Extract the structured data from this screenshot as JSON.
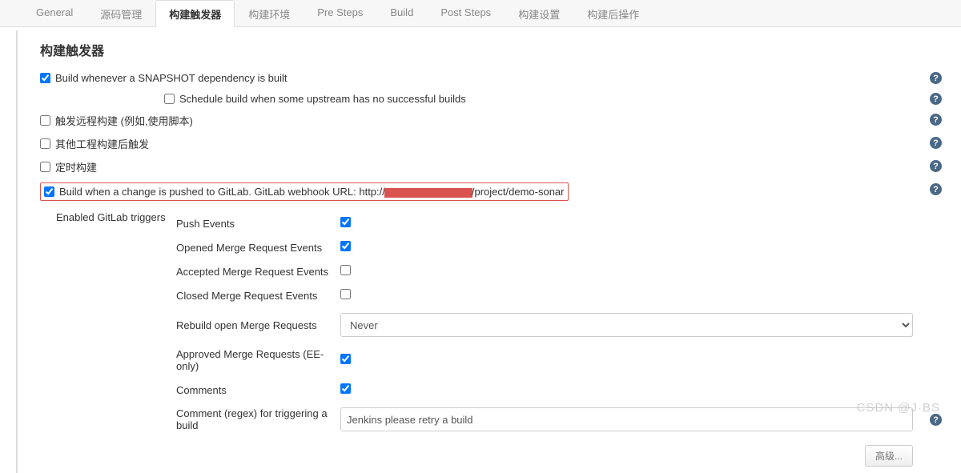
{
  "tabs": {
    "general": "General",
    "scm": "源码管理",
    "triggers": "构建触发器",
    "env": "构建环境",
    "pre": "Pre Steps",
    "build": "Build",
    "post": "Post Steps",
    "settings": "构建设置",
    "postbuild": "构建后操作"
  },
  "section_title": "构建触发器",
  "triggers": {
    "snapshot": {
      "checked": true,
      "label": "Build whenever a SNAPSHOT dependency is built"
    },
    "schedule_upstream": {
      "checked": false,
      "label": "Schedule build when some upstream has no successful builds"
    },
    "remote": {
      "checked": false,
      "label": "触发远程构建 (例如,使用脚本)"
    },
    "other_project": {
      "checked": false,
      "label": "其他工程构建后触发"
    },
    "timer": {
      "checked": false,
      "label": "定时构建"
    },
    "gitlab": {
      "checked": true,
      "label_prefix": "Build when a change is pushed to GitLab. GitLab webhook URL: http://",
      "label_suffix": "/project/demo-sonar"
    }
  },
  "gitlab_section": {
    "title": "Enabled GitLab triggers",
    "options": {
      "push": {
        "label": "Push Events",
        "checked": true
      },
      "opened_mr": {
        "label": "Opened Merge Request Events",
        "checked": true
      },
      "accepted_mr": {
        "label": "Accepted Merge Request Events",
        "checked": false
      },
      "closed_mr": {
        "label": "Closed Merge Request Events",
        "checked": false
      },
      "rebuild_mr": {
        "label": "Rebuild open Merge Requests",
        "value": "Never"
      },
      "approved_mr": {
        "label": "Approved Merge Requests (EE-only)",
        "checked": true
      },
      "comments": {
        "label": "Comments",
        "checked": true
      },
      "comment_regex": {
        "label": "Comment (regex) for triggering a build",
        "value": "Jenkins please retry a build"
      }
    }
  },
  "advanced_button": "高级...",
  "watermark": "CSDN @J·BS",
  "help_glyph": "?"
}
